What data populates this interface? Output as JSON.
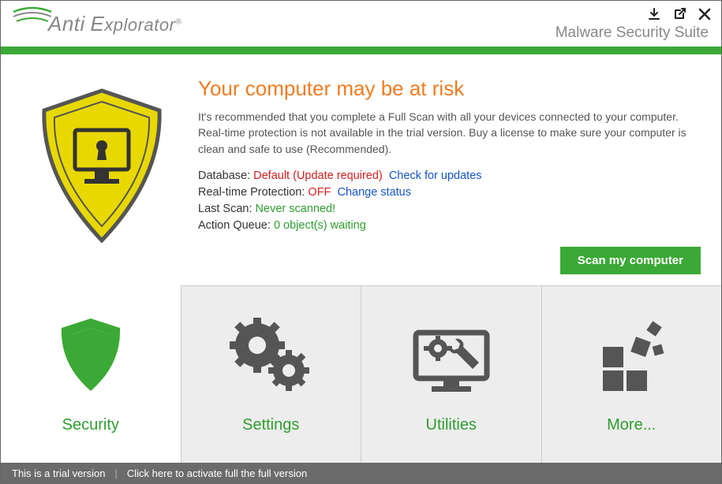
{
  "header": {
    "brand_part1": "Anti",
    "brand_part2": "Explorator",
    "suite_label": "Malware Security Suite"
  },
  "main": {
    "title": "Your computer may be at risk",
    "description": "It's recommended that you complete a Full Scan with all your devices connected to your computer. Real-time protection is not available in the trial version. Buy a license to make sure your computer is clean and safe to use (Recommended).",
    "database_label": "Database:",
    "database_value": "Default (Update required)",
    "database_link": "Check for updates",
    "rtp_label": "Real-time Protection:",
    "rtp_value": "OFF",
    "rtp_link": "Change status",
    "lastscan_label": "Last Scan:",
    "lastscan_value": "Never scanned!",
    "queue_label": "Action Queue:",
    "queue_value": "0 object(s) waiting",
    "scan_button": "Scan my computer"
  },
  "tabs": {
    "security": "Security",
    "settings": "Settings",
    "utilities": "Utilities",
    "more": "More..."
  },
  "footer": {
    "trial": "This is a trial version",
    "activate": "Click here to activate full the full version"
  }
}
